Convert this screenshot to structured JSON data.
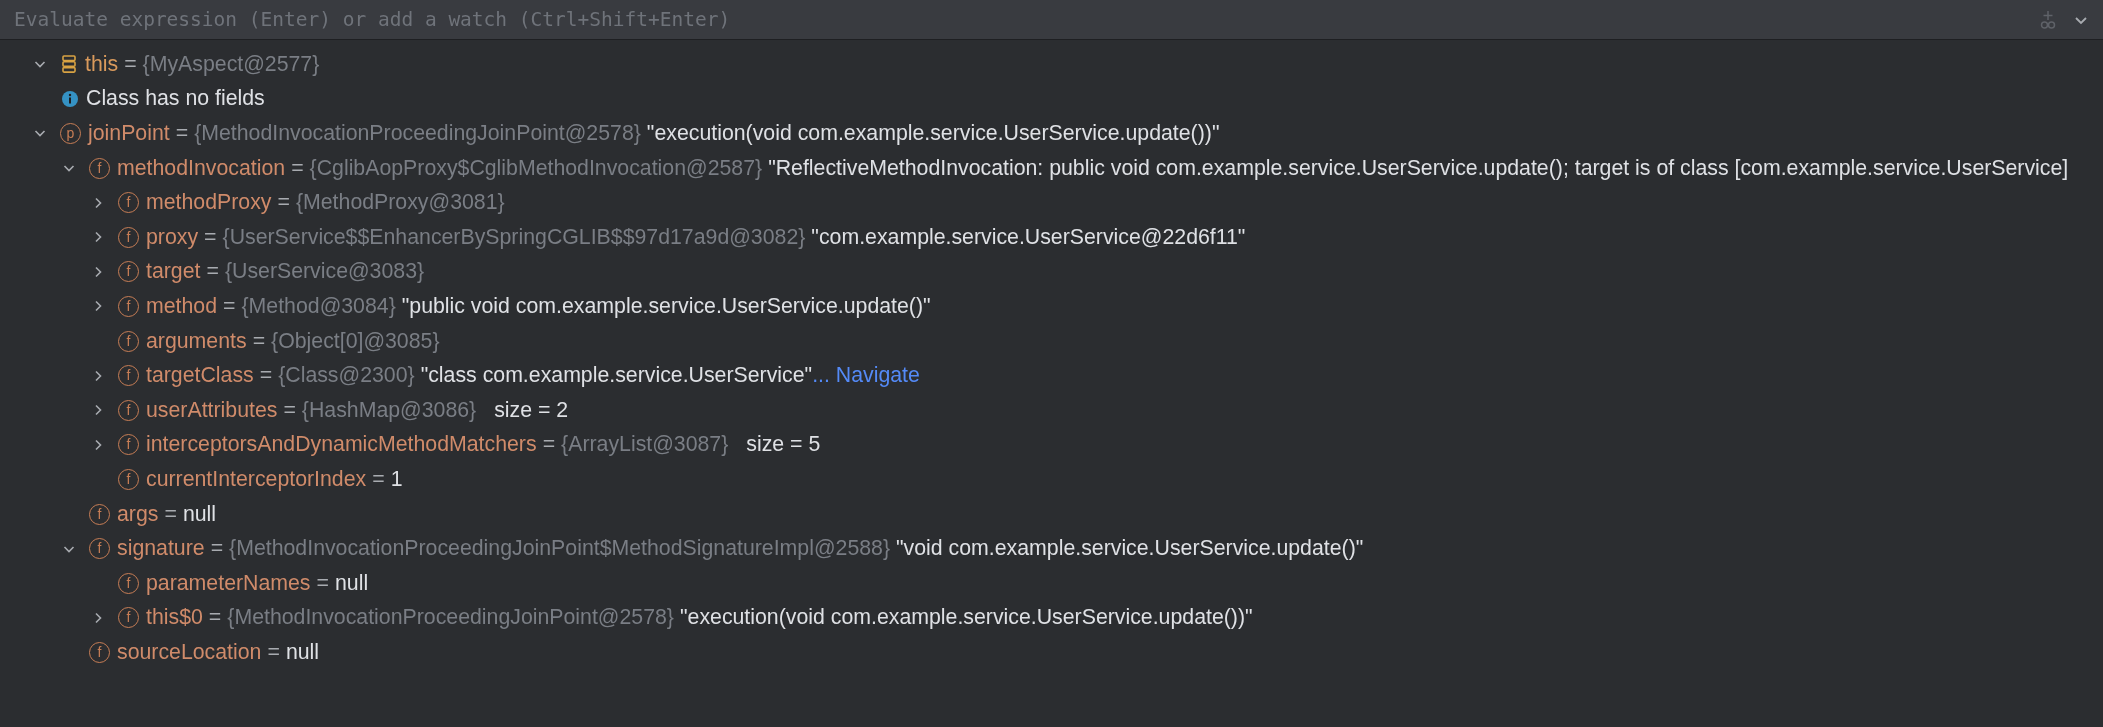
{
  "evaluate_bar": {
    "placeholder": "Evaluate expression (Enter) or add a watch (Ctrl+Shift+Enter)"
  },
  "variables": [
    {
      "kind": "object",
      "name": "this",
      "separator": "=",
      "type_ref": "{MyAspect@2577}",
      "expanded": true,
      "children": [
        {
          "kind": "info",
          "text": "Class has no fields"
        }
      ]
    },
    {
      "kind": "param",
      "icon_letter": "p",
      "name": "joinPoint",
      "separator": "=",
      "type_ref": "{MethodInvocationProceedingJoinPoint@2578}",
      "value": "\"execution(void com.example.service.UserService.update())\"",
      "expanded": true,
      "children": [
        {
          "kind": "field",
          "icon_letter": "f",
          "name": "methodInvocation",
          "separator": "=",
          "type_ref": "{CglibAopProxy$CglibMethodInvocation@2587}",
          "value": "\"ReflectiveMethodInvocation: public void com.example.service.UserService.update(); target is of class [com.example.service.UserService]",
          "expanded": true,
          "children": [
            {
              "kind": "field",
              "icon_letter": "f",
              "name": "methodProxy",
              "separator": "=",
              "type_ref": "{MethodProxy@3081}",
              "expanded": false
            },
            {
              "kind": "field",
              "icon_letter": "f",
              "name": "proxy",
              "separator": "=",
              "type_ref": "{UserService$$EnhancerBySpringCGLIB$$97d17a9d@3082}",
              "value": "\"com.example.service.UserService@22d6f11\"",
              "expanded": false
            },
            {
              "kind": "field",
              "icon_letter": "f",
              "name": "target",
              "separator": "=",
              "type_ref": "{UserService@3083}",
              "expanded": false
            },
            {
              "kind": "field",
              "icon_letter": "f",
              "name": "method",
              "separator": "=",
              "type_ref": "{Method@3084}",
              "value": "\"public void com.example.service.UserService.update()\"",
              "expanded": false
            },
            {
              "kind": "field",
              "icon_letter": "f",
              "name": "arguments",
              "separator": "=",
              "type_ref": "{Object[0]@3085}"
            },
            {
              "kind": "field",
              "icon_letter": "f",
              "name": "targetClass",
              "separator": "=",
              "type_ref": "{Class@2300}",
              "value": "\"class com.example.service.UserService\"",
              "link": "... Navigate",
              "expanded": false
            },
            {
              "kind": "field",
              "icon_letter": "f",
              "name": "userAttributes",
              "separator": "=",
              "type_ref": "{HashMap@3086}",
              "size": "size = 2",
              "expanded": false
            },
            {
              "kind": "field",
              "icon_letter": "f",
              "name": "interceptorsAndDynamicMethodMatchers",
              "separator": "=",
              "type_ref": "{ArrayList@3087}",
              "size": "size = 5",
              "expanded": false
            },
            {
              "kind": "field",
              "icon_letter": "f",
              "name": "currentInterceptorIndex",
              "separator": "=",
              "value": "1"
            }
          ]
        },
        {
          "kind": "field",
          "icon_letter": "f",
          "name": "args",
          "separator": "=",
          "value": "null"
        },
        {
          "kind": "field",
          "icon_letter": "f",
          "name": "signature",
          "separator": "=",
          "type_ref": "{MethodInvocationProceedingJoinPoint$MethodSignatureImpl@2588}",
          "value": "\"void com.example.service.UserService.update()\"",
          "expanded": true,
          "children": [
            {
              "kind": "field",
              "icon_letter": "f",
              "name": "parameterNames",
              "separator": "=",
              "value": "null"
            },
            {
              "kind": "field",
              "icon_letter": "f",
              "name": "this$0",
              "separator": "=",
              "type_ref": "{MethodInvocationProceedingJoinPoint@2578}",
              "value": "\"execution(void com.example.service.UserService.update())\"",
              "expanded": false
            }
          ]
        },
        {
          "kind": "field",
          "icon_letter": "f",
          "name": "sourceLocation",
          "separator": "=",
          "value": "null"
        }
      ]
    }
  ]
}
